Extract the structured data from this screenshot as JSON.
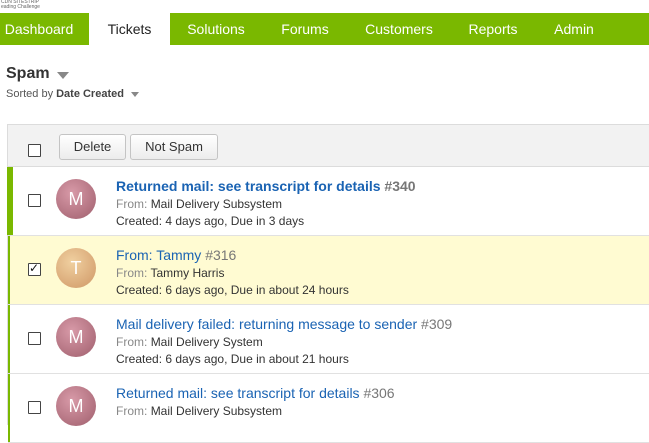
{
  "logo": {
    "line1": "CDN SITESTRIP",
    "line2": "eading Challenge"
  },
  "nav": {
    "items": [
      {
        "label": "Dashboard",
        "active": false
      },
      {
        "label": "Tickets",
        "active": true
      },
      {
        "label": "Solutions",
        "active": false
      },
      {
        "label": "Forums",
        "active": false
      },
      {
        "label": "Customers",
        "active": false
      },
      {
        "label": "Reports",
        "active": false
      },
      {
        "label": "Admin",
        "active": false
      }
    ],
    "accent_color": "#7ab800"
  },
  "header": {
    "title": "Spam",
    "sort_prefix": "Sorted by",
    "sort_value": "Date Created"
  },
  "toolbar": {
    "delete_label": "Delete",
    "not_spam_label": "Not Spam"
  },
  "tickets": [
    {
      "title": "Returned mail: see transcript for details",
      "number": "#340",
      "from_label": "From:",
      "from": "Mail Delivery Subsystem",
      "created": "Created: 4 days ago, Due in 3 days",
      "avatar_letter": "M",
      "unread": true,
      "checked": false
    },
    {
      "title": "From: Tammy",
      "number": "#316",
      "from_label": "From:",
      "from": "Tammy Harris",
      "created": "Created: 6 days ago, Due in about 24 hours",
      "avatar_letter": "T",
      "unread": false,
      "checked": true
    },
    {
      "title": "Mail delivery failed: returning message to sender",
      "number": "#309",
      "from_label": "From:",
      "from": "Mail Delivery System",
      "created": "Created: 6 days ago, Due in about 21 hours",
      "avatar_letter": "M",
      "unread": false,
      "checked": false
    },
    {
      "title": "Returned mail: see transcript for details",
      "number": "#306",
      "from_label": "From:",
      "from": "Mail Delivery Subsystem",
      "created": "",
      "avatar_letter": "M",
      "unread": false,
      "checked": false
    }
  ]
}
